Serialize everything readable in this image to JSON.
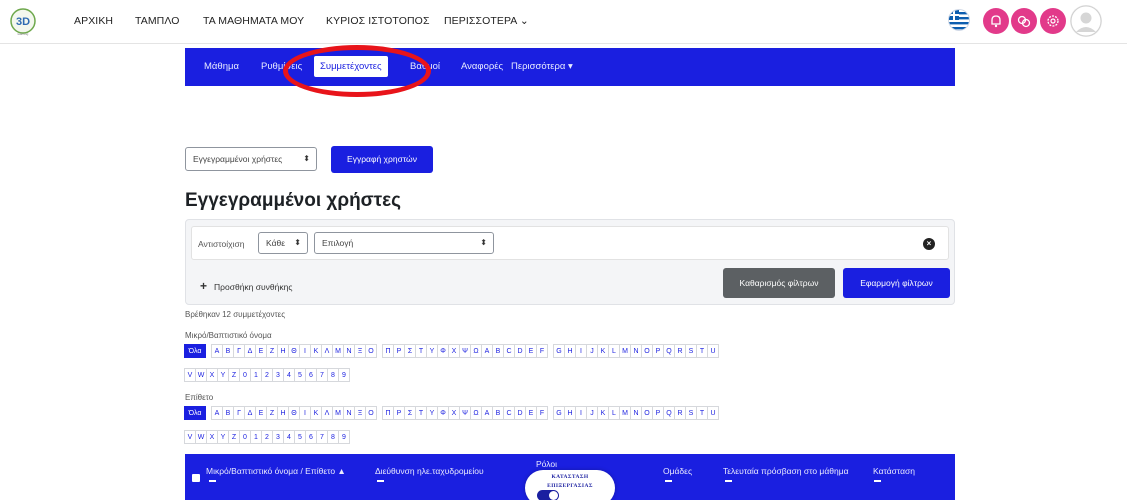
{
  "topnav": {
    "links": [
      "ΑΡΧΙΚΗ",
      "ΤΑΜΠΛΟ",
      "ΤΑ ΜΑΘΗΜΑΤΑ ΜΟΥ",
      "ΚΥΡΙΟΣ ΙΣΤΟΤΟΠΟΣ",
      "ΠΕΡΙΣΣΟΤΕΡΑ ⌄"
    ],
    "accent_color": "#e23a8a"
  },
  "course_nav": {
    "tabs": [
      "Μάθημα",
      "Ρυθμίσεις",
      "Συμμετέχοντες",
      "Βαθμοί",
      "Αναφορές",
      "Περισσότερα ▾"
    ],
    "active_tab": "Συμμετέχοντες",
    "color": "#1a1fe0"
  },
  "enrol": {
    "select_value": "Εγγεγραμμένοι χρήστες",
    "button_label": "Εγγραφή χρηστών"
  },
  "page_title": "Εγγεγραμμένοι χρήστες",
  "filter": {
    "match_label": "Αντιστοίχιση",
    "match_value": "Κάθε",
    "type_value": "Επιλογή",
    "add_condition": "Προσθήκη συνθήκης",
    "clear_button": "Καθαρισμός φίλτρων",
    "apply_button": "Εφαρμογή φίλτρων"
  },
  "found_text": "Βρέθηκαν 12 συμμετέχοντες",
  "initials": {
    "firstname_label": "Μικρό/Βαπτιστικό όνομα",
    "lastname_label": "Επίθετο",
    "all_label": "Όλα",
    "greek": [
      "Α",
      "Β",
      "Γ",
      "Δ",
      "Ε",
      "Ζ",
      "Η",
      "Θ",
      "Ι",
      "Κ",
      "Λ",
      "Μ",
      "Ν",
      "Ξ",
      "Ο"
    ],
    "greek2": [
      "Π",
      "Ρ",
      "Σ",
      "Τ",
      "Υ",
      "Φ",
      "Χ",
      "Ψ",
      "Ω",
      "A",
      "B",
      "C",
      "D",
      "E",
      "F"
    ],
    "latin": [
      "G",
      "H",
      "I",
      "J",
      "K",
      "L",
      "M",
      "N",
      "O",
      "P",
      "Q",
      "R",
      "S",
      "T",
      "U"
    ],
    "row2": [
      "V",
      "W",
      "X",
      "Y",
      "Z",
      "0",
      "1",
      "2",
      "3",
      "4",
      "5",
      "6",
      "7",
      "8",
      "9"
    ]
  },
  "table": {
    "columns": [
      "Μικρό/Βαπτιστικό όνομα / Επίθετο ▲",
      "Διεύθυνση ηλε.ταχυδρομείου",
      "Ρόλοι",
      "Ομάδες",
      "Τελευταία πρόσβαση στο μάθημα",
      "Κατάσταση"
    ]
  },
  "widget": {
    "line1": "ΚΑΤΑΣΤΑΣΗ",
    "line2": "ΕΠΙΞΕΡΓΑΣΙΑΣ"
  }
}
